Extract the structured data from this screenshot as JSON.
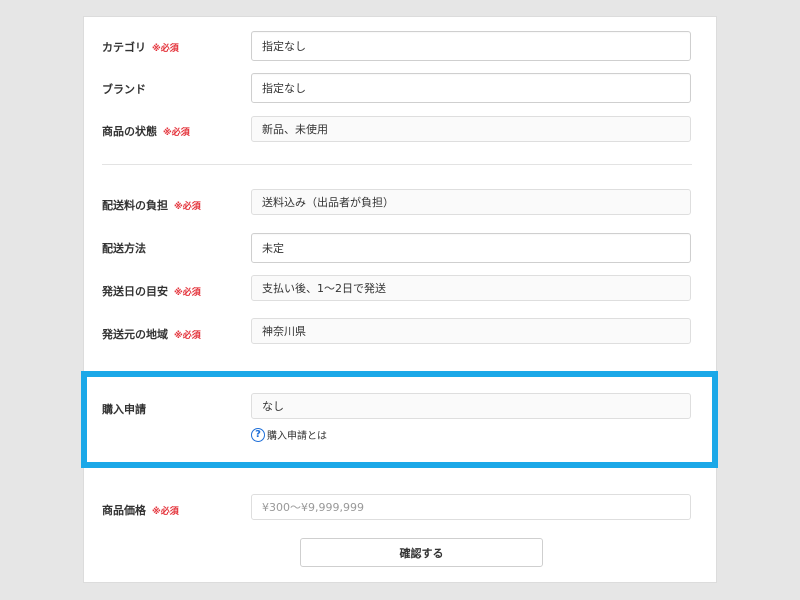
{
  "required_mark": "※必須",
  "product_details": {
    "category": {
      "label": "カテゴリ",
      "required": true,
      "value": "指定なし"
    },
    "brand": {
      "label": "ブランド",
      "required": false,
      "value": "指定なし"
    },
    "condition": {
      "label": "商品の状態",
      "required": true,
      "value": "新品、未使用"
    }
  },
  "shipping": {
    "fee_payer": {
      "label": "配送料の負担",
      "required": true,
      "value": "送料込み（出品者が負担）"
    },
    "method": {
      "label": "配送方法",
      "required": false,
      "value": "未定"
    },
    "days_to_ship": {
      "label": "発送日の目安",
      "required": true,
      "value": "支払い後、1〜2日で発送"
    },
    "ship_from": {
      "label": "発送元の地域",
      "required": true,
      "value": "神奈川県"
    }
  },
  "purchase_request": {
    "label": "購入申請",
    "value": "なし",
    "help_icon": "question-circle-icon",
    "help_text": "購入申請とは"
  },
  "price": {
    "label": "商品価格",
    "required": true,
    "placeholder": "¥300〜¥9,999,999"
  },
  "confirm_button": "確認する",
  "colors": {
    "highlight": "#1ba8e8",
    "required": "#e4323a",
    "help_icon": "#1f6fd8"
  }
}
